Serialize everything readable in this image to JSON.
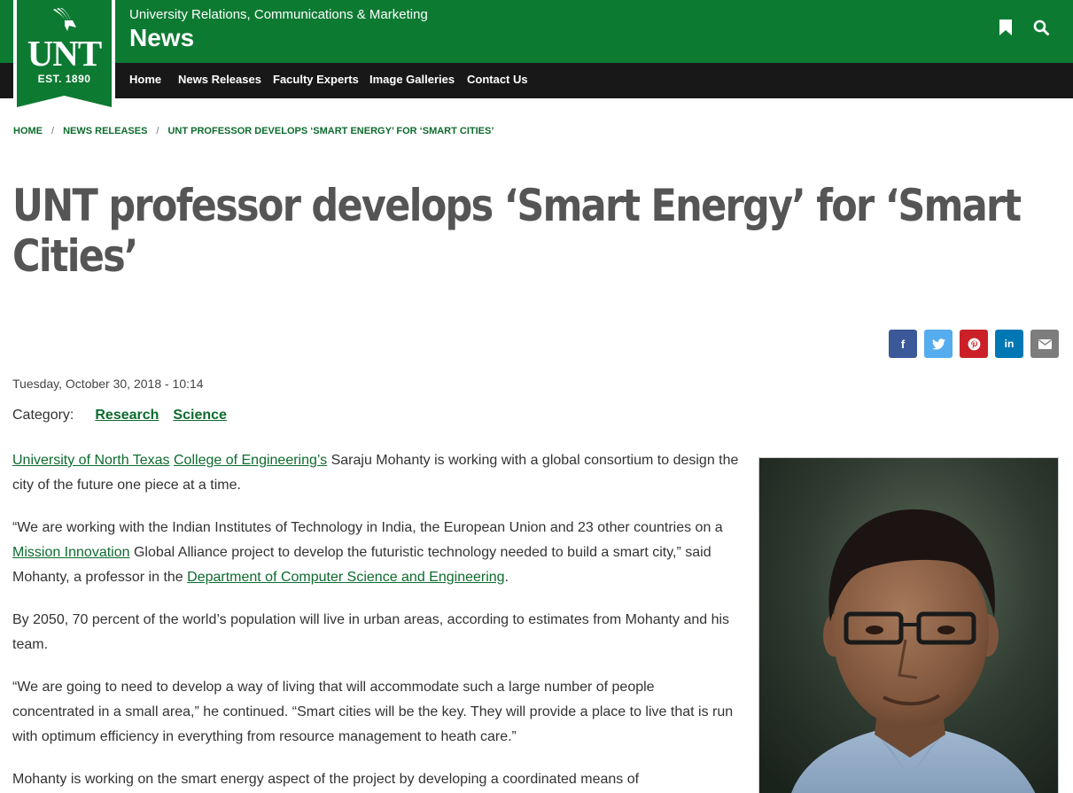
{
  "header": {
    "department": "University Relations, Communications & Marketing",
    "site_title": "News",
    "bookmark_icon": "bookmark-icon",
    "search_icon": "search-icon",
    "brand_color": "#0d7a32"
  },
  "logo": {
    "name": "UNT",
    "est": "EST. 1890",
    "icon": "eagle-icon"
  },
  "nav": {
    "items": [
      {
        "label": "Home"
      },
      {
        "label": "News Releases"
      },
      {
        "label": "Faculty Experts"
      },
      {
        "label": "Image Galleries"
      },
      {
        "label": "Contact Us"
      }
    ]
  },
  "breadcrumb": {
    "separator": "/",
    "items": [
      {
        "label": "HOME"
      },
      {
        "label": "NEWS RELEASES"
      },
      {
        "label": "UNT PROFESSOR DEVELOPS ‘SMART ENERGY’ FOR ‘SMART CITIES’"
      }
    ]
  },
  "article": {
    "title": "UNT professor develops ‘Smart Energy’ for ‘Smart Cities’",
    "date": "Tuesday, October 30, 2018 - 10:14",
    "category_label": "Category:",
    "categories": [
      "Research",
      "Science"
    ],
    "p1": {
      "link1": "University of North Texas",
      "link2": "College of Engineering’s",
      "text": " Saraju Mohanty is working with a global consortium to design the city of the future one piece at a time."
    },
    "p2": {
      "text1": "“We are working with the Indian Institutes of Technology in India, the European Union and 23 other countries on a ",
      "link1": "Mission Innovation",
      "text2": " Global Alliance project to develop the futuristic technology needed to build a smart city,” said Mohanty, a professor in the ",
      "link2": "Department of Computer Science and Engineering",
      "text3": "."
    },
    "p3": "By 2050, 70 percent of the world’s population will live in urban areas, according to estimates from Mohanty and his team.",
    "p4": "“We are going to need to develop a way of living that will accommodate such a large number of people concentrated in a small area,” he continued. “Smart cities will be the key. They will provide a place to live that is run with optimum efficiency in everything from resource management to heath care.”",
    "p5": "Mohanty is working on the smart energy aspect of the project by developing a coordinated means of"
  },
  "share": {
    "facebook": "f",
    "twitter_icon": "twitter-icon",
    "pinterest_icon": "pinterest-icon",
    "linkedin": "in",
    "email_icon": "email-icon",
    "colors": {
      "facebook": "#3b5998",
      "twitter": "#55acee",
      "pinterest": "#cb2027",
      "linkedin": "#0077b5",
      "email": "#7d7d7d"
    }
  }
}
